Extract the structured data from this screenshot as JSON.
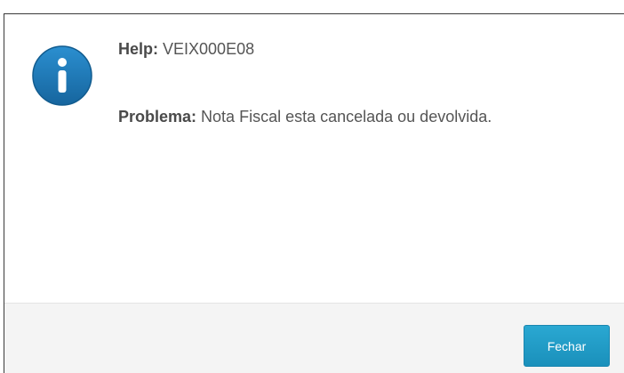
{
  "dialog": {
    "icon": "info-icon",
    "help_label": "Help:",
    "help_code": "VEIX000E08",
    "problem_label": "Problema:",
    "problem_text": "Nota Fiscal esta cancelada ou devolvida."
  },
  "footer": {
    "close_label": "Fechar"
  },
  "colors": {
    "accent": "#1f9cc6",
    "icon_blue": "#1a7fc0",
    "text": "#555555"
  }
}
